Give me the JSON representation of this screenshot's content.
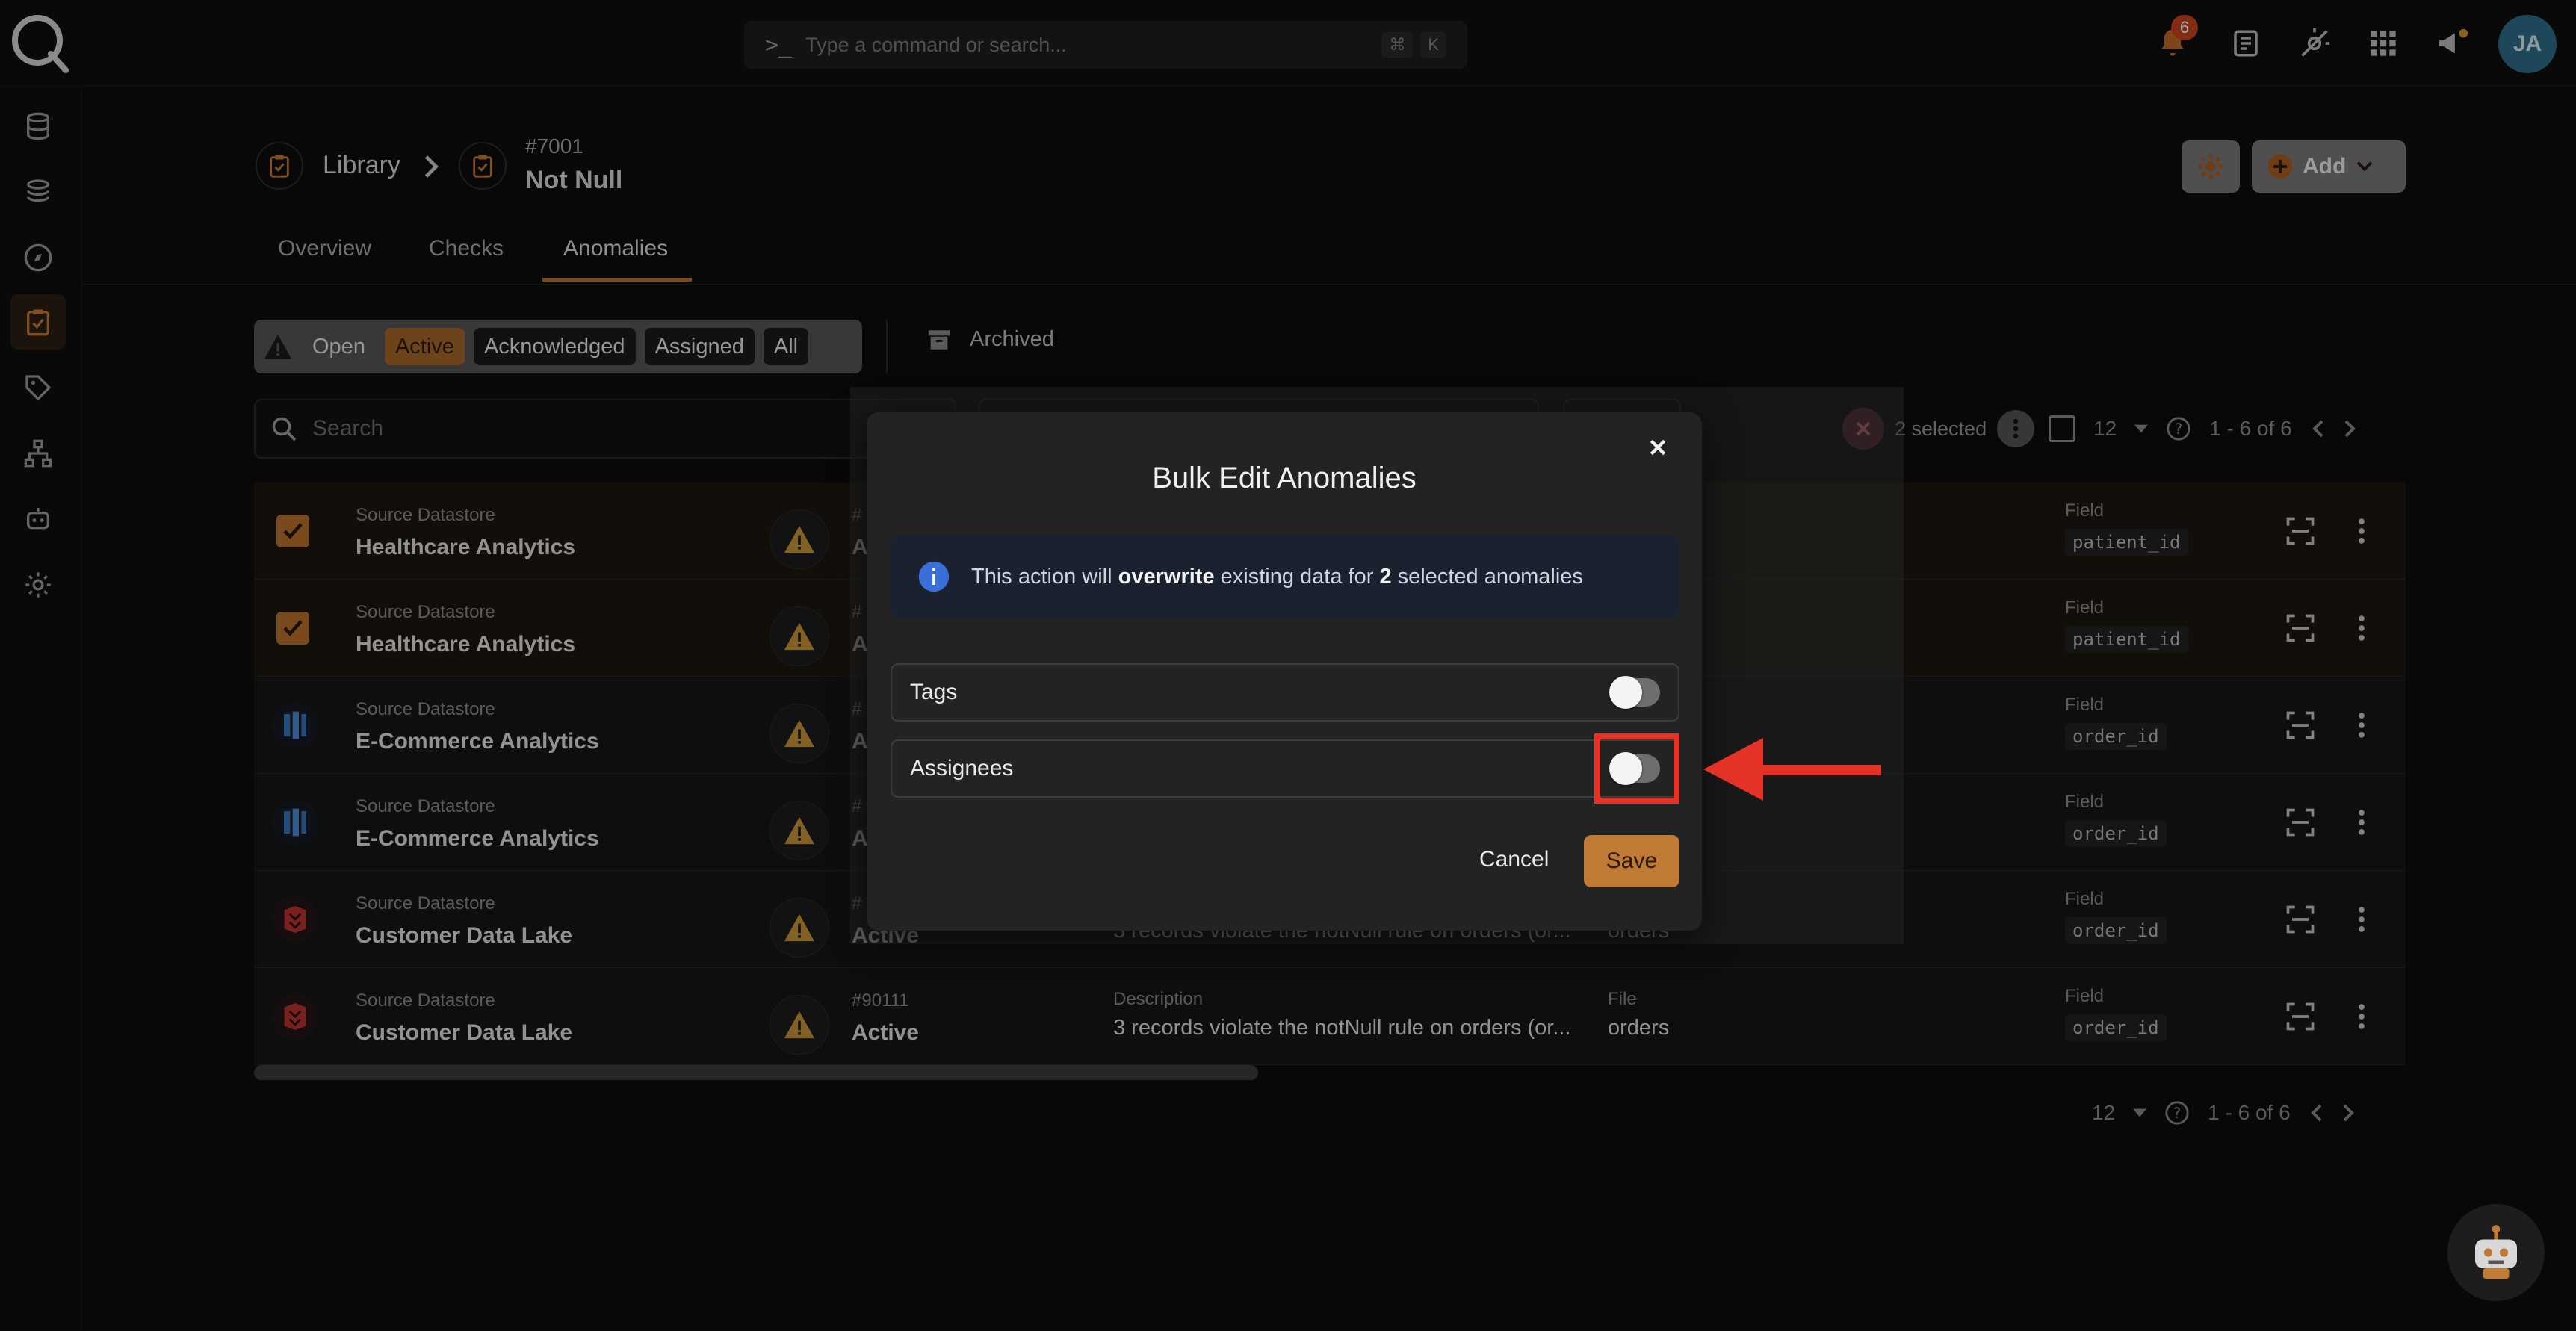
{
  "topbar": {
    "command_placeholder": "Type a command or search...",
    "shortcut_mod": "⌘",
    "shortcut_key": "K",
    "notifications_count": "6",
    "user_initials": "JA"
  },
  "breadcrumb": {
    "parent": "Library",
    "number": "#7001",
    "title": "Not Null"
  },
  "header_actions": {
    "add_label": "Add"
  },
  "tabs": [
    {
      "label": "Overview"
    },
    {
      "label": "Checks"
    },
    {
      "label": "Anomalies",
      "active": true
    }
  ],
  "filters": {
    "open_label": "Open",
    "chips": [
      "Active",
      "Acknowledged",
      "Assigned",
      "All"
    ],
    "archived_label": "Archived"
  },
  "search": {
    "placeholder": "Search"
  },
  "selection": {
    "selected_text": "2 selected",
    "page_size": "12",
    "range": "1 - 6 of 6"
  },
  "rows": [
    {
      "ds_label": "Source Datastore",
      "ds_name": "Healthcare Analytics",
      "id": "#",
      "status": "Ac",
      "field_label": "Field",
      "field": "patient_id",
      "selected": true
    },
    {
      "ds_label": "Source Datastore",
      "ds_name": "Healthcare Analytics",
      "id": "#",
      "status": "Ac",
      "field_label": "Field",
      "field": "patient_id",
      "selected": true
    },
    {
      "ds_label": "Source Datastore",
      "ds_name": "E-Commerce Analytics",
      "id": "#",
      "status": "Ac",
      "field_label": "Field",
      "field": "order_id",
      "selected": false
    },
    {
      "ds_label": "Source Datastore",
      "ds_name": "E-Commerce Analytics",
      "id": "#",
      "status": "Ac",
      "field_label": "Field",
      "field": "order_id",
      "selected": false
    },
    {
      "ds_label": "Source Datastore",
      "ds_name": "Customer Data Lake",
      "id": "#",
      "status": "Active",
      "desc": "3 records violate the notNull rule on orders (or...",
      "file": "orders",
      "field_label": "Field",
      "field": "order_id",
      "selected": false
    },
    {
      "ds_label": "Source Datastore",
      "ds_name": "Customer Data Lake",
      "id": "#90111",
      "status": "Active",
      "desc_label": "Description",
      "desc": "3 records violate the notNull rule on orders (or...",
      "file_label": "File",
      "file": "orders",
      "field_label": "Field",
      "field": "order_id",
      "selected": false
    }
  ],
  "pager_bottom": {
    "page_size": "12",
    "range": "1 - 6 of 6"
  },
  "modal": {
    "title": "Bulk Edit Anomalies",
    "info_prefix": "This action will",
    "info_bold1": "overwrite",
    "info_mid": "existing data for",
    "info_bold2": "2",
    "info_suffix": "selected anomalies",
    "fields": [
      {
        "label": "Tags",
        "enabled": false
      },
      {
        "label": "Assignees",
        "enabled": false
      }
    ],
    "cancel_label": "Cancel",
    "save_label": "Save"
  },
  "colors": {
    "accent": "#c07a35",
    "highlight": "#e53226",
    "background": "#0d0d0d"
  }
}
